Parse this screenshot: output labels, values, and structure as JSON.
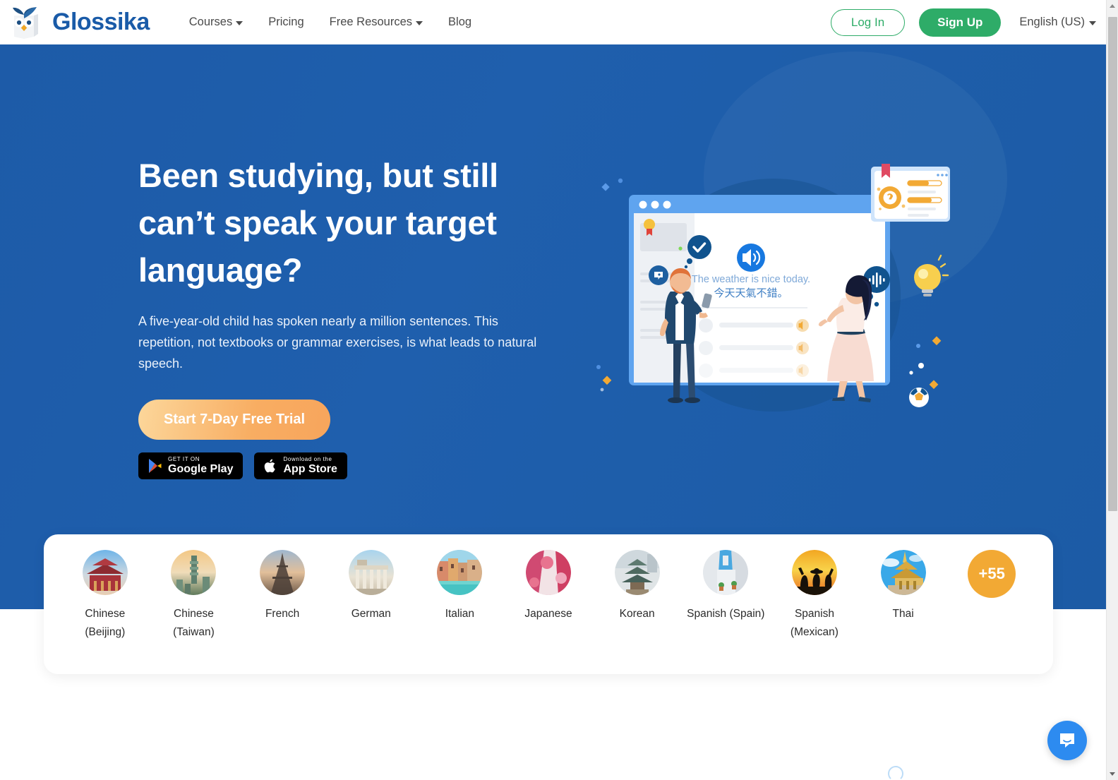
{
  "brand": {
    "name": "Glossika",
    "logo_icon": "owl-logo-icon",
    "color": "#1a5ba8"
  },
  "header": {
    "nav": [
      {
        "label": "Courses",
        "has_dropdown": true
      },
      {
        "label": "Pricing",
        "has_dropdown": false
      },
      {
        "label": "Free Resources",
        "has_dropdown": true
      },
      {
        "label": "Blog",
        "has_dropdown": false
      }
    ],
    "login_label": "Log In",
    "signup_label": "Sign Up",
    "language": "English (US)",
    "accent_green": "#2eac68"
  },
  "hero": {
    "title": "Been studying, but still can’t speak your target language?",
    "subtitle": "A five-year-old child has spoken nearly a million sentences. This repetition, not textbooks or grammar exercises, is what leads to natural speech.",
    "cta_label": "Start 7-Day Free Trial",
    "background_color": "#1d5ba8",
    "cta_color": "#f8ad62",
    "stores": [
      {
        "top": "GET IT ON",
        "bottom": "Google Play",
        "icon": "google-play-icon"
      },
      {
        "top": "Download on the",
        "bottom": "App Store",
        "icon": "apple-icon"
      }
    ],
    "illustration": {
      "sentence_en": "The weather is nice today.",
      "sentence_zh": "今天天氣不錯。",
      "icons": [
        "speaker-icon",
        "waveform-icon",
        "check-badge-icon",
        "chat-bubble-icon",
        "lightbulb-icon",
        "medal-icon",
        "brain-icon"
      ]
    }
  },
  "languages": {
    "items": [
      {
        "label": "Chinese\n(Beijing)",
        "thumb": "beijing-temple-photo"
      },
      {
        "label": "Chinese\n(Taiwan)",
        "thumb": "taipei-skyline-photo"
      },
      {
        "label": "French",
        "thumb": "eiffel-tower-photo"
      },
      {
        "label": "German",
        "thumb": "brandenburg-gate-photo"
      },
      {
        "label": "Italian",
        "thumb": "venice-canal-photo"
      },
      {
        "label": "Japanese",
        "thumb": "kimono-photo"
      },
      {
        "label": "Korean",
        "thumb": "korean-pagoda-photo"
      },
      {
        "label": "Spanish (Spain)",
        "thumb": "spanish-alley-photo"
      },
      {
        "label": "Spanish\n(Mexican)",
        "thumb": "mariachi-sunset-photo"
      },
      {
        "label": "Thai",
        "thumb": "thai-temple-photo"
      }
    ],
    "more_label": "+55",
    "more_color": "#f2a934"
  },
  "chat": {
    "icon": "intercom-chat-icon",
    "color": "#2d8bf0"
  }
}
